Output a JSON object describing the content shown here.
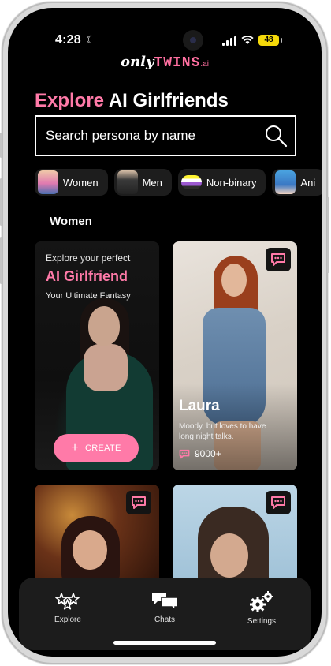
{
  "status_bar": {
    "time": "4:28",
    "battery": "48"
  },
  "logo": {
    "part1": "only",
    "part2": "TWINS",
    "part3": ".ai"
  },
  "headline": {
    "accent": "Explore",
    "rest": "AI Girlfriends"
  },
  "search": {
    "placeholder": "Search persona by name"
  },
  "chips": [
    {
      "label": "Women"
    },
    {
      "label": "Men"
    },
    {
      "label": "Non-binary"
    },
    {
      "label": "Ani"
    }
  ],
  "section": {
    "title": "Women"
  },
  "create_card": {
    "subtitle": "Explore your perfect",
    "title": "AI Girlfriend",
    "tagline": "Your Ultimate Fantasy",
    "button": "CREATE"
  },
  "persona_card": {
    "name": "Laura",
    "description": "Moody, but loves to have long night talks.",
    "count": "9000+"
  },
  "bottom_nav": [
    {
      "label": "Explore",
      "icon": "stars-icon"
    },
    {
      "label": "Chats",
      "icon": "chat-bubbles-icon"
    },
    {
      "label": "Settings",
      "icon": "gears-icon"
    }
  ],
  "colors": {
    "accent": "#ff7aa8",
    "background": "#000000"
  }
}
